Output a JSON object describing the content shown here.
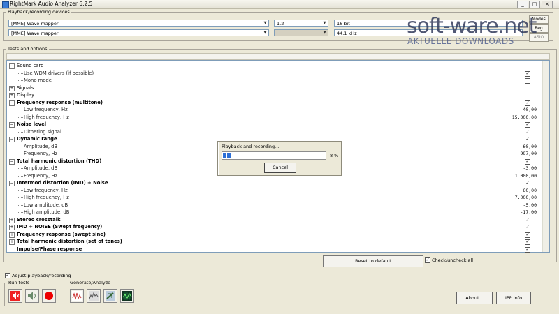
{
  "window": {
    "title": "RightMark Audio Analyzer 6.2.5",
    "minimize": "_",
    "maximize": "□",
    "close": "×"
  },
  "playback": {
    "group_label": "Playback/recording devices",
    "playback_device": "[MME] Wave mapper",
    "recording_device": "[MME] Wave mapper",
    "channels": "1.2",
    "bit_depth": "16 bit",
    "sample_rate": "44.1 kHz",
    "modes": [
      "Modes",
      "Reg",
      "ASIO"
    ]
  },
  "watermark": {
    "line1": "soft-ware.net",
    "line2": "AKTUELLE DOWNLOADS"
  },
  "tests": {
    "group_label": "Tests and options",
    "rows": [
      {
        "label": "Sound card",
        "type": "parent",
        "exp": "⊟",
        "bold": false,
        "value": "",
        "check": ""
      },
      {
        "label": "Use WDM drivers (if possible)",
        "type": "child",
        "value": "",
        "check": "✓"
      },
      {
        "label": "Mono mode",
        "type": "child",
        "value": "",
        "check": " "
      },
      {
        "label": "Signals",
        "type": "parent",
        "exp": "⊞",
        "bold": false,
        "value": "",
        "check": ""
      },
      {
        "label": "Display",
        "type": "parent",
        "exp": "⊞",
        "bold": false,
        "value": "",
        "check": ""
      },
      {
        "label": "Frequency response (multitone)",
        "type": "parent",
        "exp": "⊟",
        "bold": true,
        "value": "",
        "check": "✓"
      },
      {
        "label": "Low frequency, Hz",
        "type": "child",
        "value": "40,00",
        "check": ""
      },
      {
        "label": "High frequency, Hz",
        "type": "child",
        "value": "15.000,00",
        "check": ""
      },
      {
        "label": "Noise level",
        "type": "parent",
        "exp": "⊟",
        "bold": true,
        "value": "",
        "check": "✓"
      },
      {
        "label": "Dithering signal",
        "type": "child",
        "value": "",
        "check": "✓",
        "check_disabled": true
      },
      {
        "label": "Dynamic range",
        "type": "parent",
        "exp": "⊟",
        "bold": true,
        "value": "",
        "check": "✓"
      },
      {
        "label": "Amplitude, dB",
        "type": "child",
        "value": "-60,00",
        "check": ""
      },
      {
        "label": "Frequency, Hz",
        "type": "child",
        "value": "997,00",
        "check": ""
      },
      {
        "label": "Total harmonic distortion (THD)",
        "type": "parent",
        "exp": "⊟",
        "bold": true,
        "value": "",
        "check": "✓"
      },
      {
        "label": "Amplitude, dB",
        "type": "child",
        "value": "-3,00",
        "check": ""
      },
      {
        "label": "Frequency, Hz",
        "type": "child",
        "value": "1.000,00",
        "check": ""
      },
      {
        "label": "Intermod distortion (IMD) + Noise",
        "type": "parent",
        "exp": "⊟",
        "bold": true,
        "value": "",
        "check": "✓"
      },
      {
        "label": "Low frequency, Hz",
        "type": "child",
        "value": "60,00",
        "check": ""
      },
      {
        "label": "High frequency, Hz",
        "type": "child",
        "value": "7.000,00",
        "check": ""
      },
      {
        "label": "Low amplitude, dB",
        "type": "child",
        "value": "-5,00",
        "check": ""
      },
      {
        "label": "High amplitude, dB",
        "type": "child",
        "value": "-17,00",
        "check": ""
      },
      {
        "label": "Stereo crosstalk",
        "type": "parent",
        "exp": "⊞",
        "bold": true,
        "value": "",
        "check": "✓"
      },
      {
        "label": "IMD + NOISE (Swept frequency)",
        "type": "parent",
        "exp": "⊞",
        "bold": true,
        "value": "",
        "check": "✓"
      },
      {
        "label": "Frequency response (swept sine)",
        "type": "parent",
        "exp": "⊞",
        "bold": true,
        "value": "",
        "check": "✓"
      },
      {
        "label": "Total harmonic distortion (set of tones)",
        "type": "parent",
        "exp": "⊞",
        "bold": true,
        "value": "",
        "check": "✓"
      },
      {
        "label": "Impulse/Phase response",
        "type": "parent",
        "exp": "",
        "bold": true,
        "value": "",
        "check": "✓"
      }
    ]
  },
  "dialog": {
    "title": "Playback and recording...",
    "progress_percent": 8,
    "progress_text": "8 %",
    "cancel": "Cancel"
  },
  "controls": {
    "reset_default": "Reset to default",
    "check_all": "Check/uncheck all",
    "adjust": "Adjust playback/recording",
    "run_tests_label": "Run tests",
    "generate_label": "Generate/Analyze",
    "about": "About...",
    "ipp_info": "IPP Info"
  }
}
